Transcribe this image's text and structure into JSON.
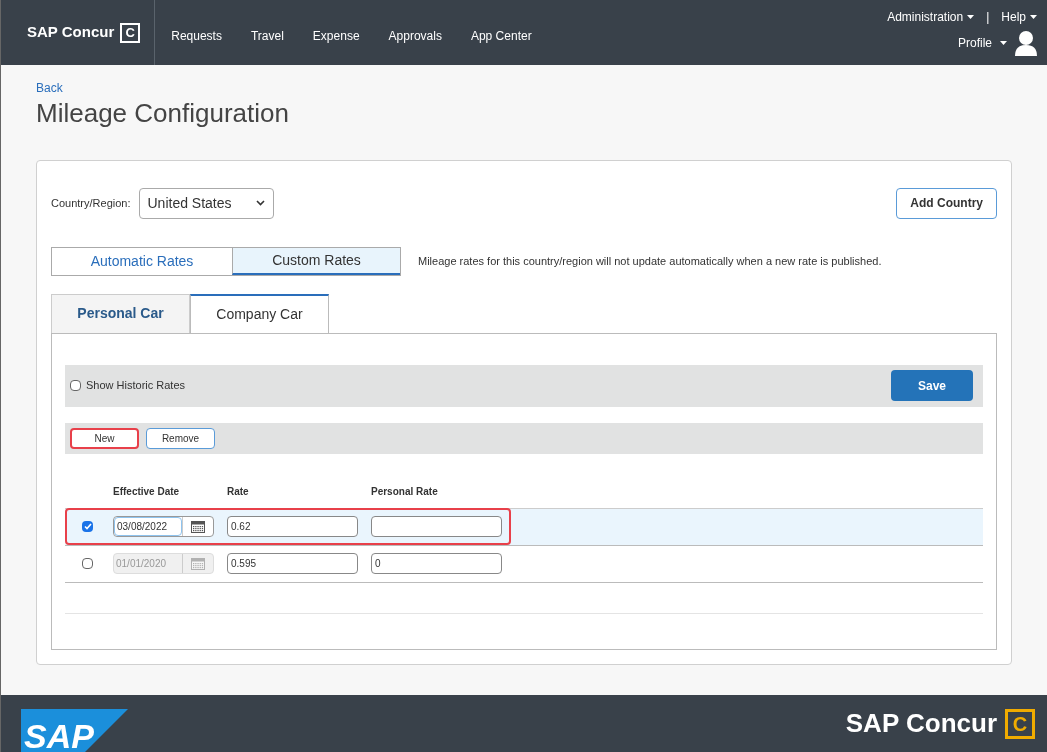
{
  "header": {
    "brand": "SAP Concur",
    "brand_mark": "C",
    "nav": [
      {
        "label": "Requests",
        "selected": false
      },
      {
        "label": "Travel",
        "selected": false
      },
      {
        "label": "Expense",
        "selected": false
      },
      {
        "label": "Approvals",
        "selected": false
      },
      {
        "label": "App Center",
        "selected": false
      }
    ],
    "admin_menu": "Administration",
    "separator": "|",
    "help_menu": "Help",
    "profile_menu": "Profile"
  },
  "back_link": "Back",
  "title": "Mileage Configuration",
  "country": {
    "label": "Country/Region:",
    "value": "United States"
  },
  "add_country_button": "Add Country",
  "rate_tabs": [
    {
      "label": "Automatic Rates",
      "selected": false
    },
    {
      "label": "Custom Rates",
      "selected": true
    }
  ],
  "rate_note": "Mileage rates for this country/region will not update automatically when a new rate is published.",
  "car_tabs": [
    {
      "label": "Personal Car",
      "selected": false
    },
    {
      "label": "Company Car",
      "selected": true
    }
  ],
  "show_historic": {
    "label": "Show Historic Rates",
    "checked": false
  },
  "save_button": "Save",
  "actions": [
    {
      "label": "New",
      "highlighted": true
    },
    {
      "label": "Remove",
      "highlighted": false
    }
  ],
  "table": {
    "columns": [
      "Effective Date",
      "Rate",
      "Personal Rate"
    ],
    "rows": [
      {
        "checked": true,
        "highlighted": true,
        "date": "03/08/2022",
        "date_disabled": false,
        "rate": "0.62",
        "personal_rate": ""
      },
      {
        "checked": false,
        "highlighted": false,
        "date": "01/01/2020",
        "date_disabled": true,
        "rate": "0.595",
        "personal_rate": "0"
      }
    ]
  },
  "footer": {
    "sap_logo": "SAP",
    "brand": "SAP Concur",
    "brand_mark": "C"
  }
}
